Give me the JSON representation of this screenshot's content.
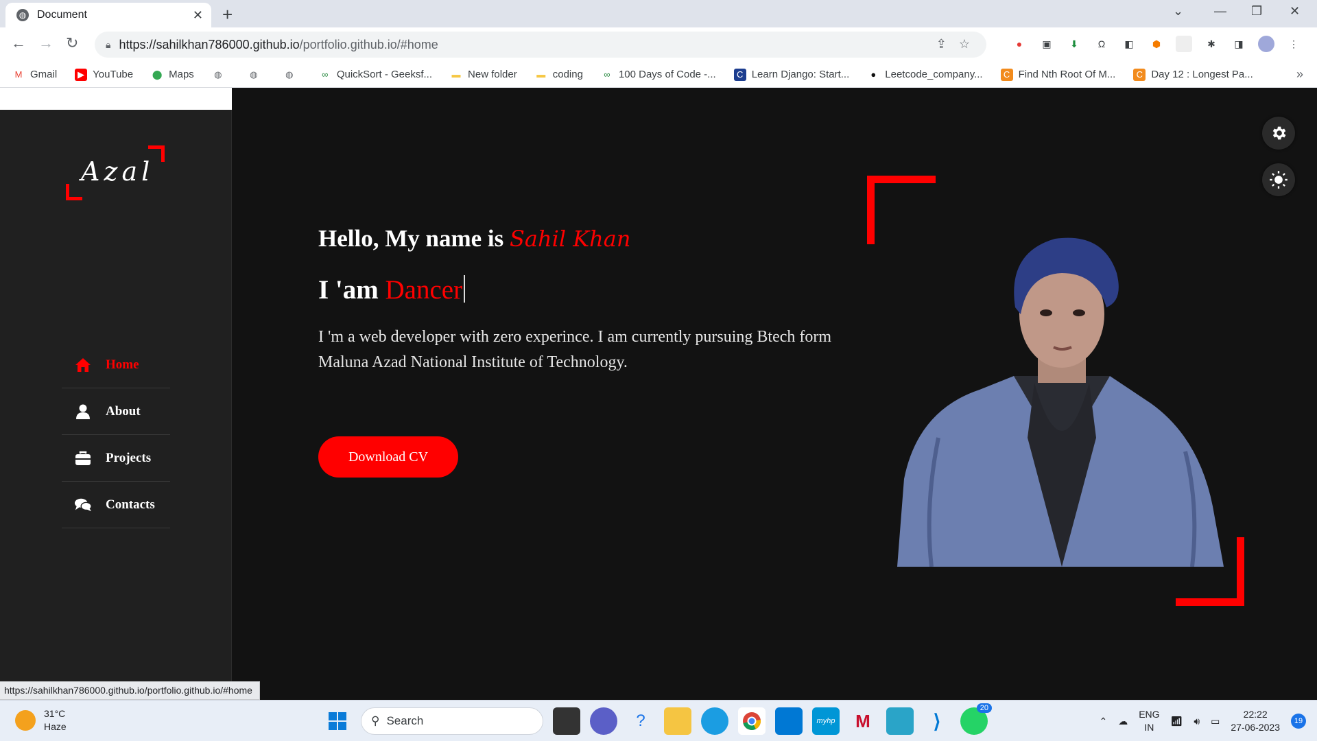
{
  "browser": {
    "tab_title": "Document",
    "url_host": "https://sahilkhan786000.github.io",
    "url_path": "/portfolio.github.io/#home",
    "status_url": "https://sahilkhan786000.github.io/portfolio.github.io/#home",
    "bookmarks": [
      {
        "label": "Gmail",
        "icon": "gmail-icon"
      },
      {
        "label": "YouTube",
        "icon": "youtube-icon"
      },
      {
        "label": "Maps",
        "icon": "maps-icon"
      },
      {
        "label": "",
        "icon": "globe-icon"
      },
      {
        "label": "",
        "icon": "globe-icon"
      },
      {
        "label": "",
        "icon": "globe-icon"
      },
      {
        "label": "QuickSort - Geeksf...",
        "icon": "gfg-icon"
      },
      {
        "label": "New folder",
        "icon": "folder-icon"
      },
      {
        "label": "coding",
        "icon": "folder-icon"
      },
      {
        "label": "100 Days of Code -...",
        "icon": "gfg-icon"
      },
      {
        "label": "Learn Django: Start...",
        "icon": "cal-icon"
      },
      {
        "label": "Leetcode_company...",
        "icon": "github-icon"
      },
      {
        "label": "Find Nth Root Of M...",
        "icon": "codestudio-icon"
      },
      {
        "label": "Day 12 : Longest Pa...",
        "icon": "codestudio-icon"
      }
    ]
  },
  "site": {
    "logo": "Azal",
    "nav": [
      {
        "label": "Home",
        "icon": "home-icon",
        "active": true
      },
      {
        "label": "About",
        "icon": "user-icon",
        "active": false
      },
      {
        "label": "Projects",
        "icon": "briefcase-icon",
        "active": false
      },
      {
        "label": "Contacts",
        "icon": "comments-icon",
        "active": false
      }
    ],
    "hero": {
      "greeting_prefix": "Hello, My name is ",
      "name": "Sahil Khan",
      "role_prefix": "I 'am ",
      "role_word": "Dancer",
      "bio": "I 'm a web developer with zero experince. I am currently pursuing Btech form Maluna Azad National Institute of Technology.",
      "cv_button": "Download CV"
    },
    "colors": {
      "accent": "#ff0000",
      "background": "#121212",
      "sidebar": "#202020"
    }
  },
  "taskbar": {
    "weather_temp": "31°C",
    "weather_desc": "Haze",
    "search_placeholder": "Search",
    "whatsapp_badge": "20",
    "lang_top": "ENG",
    "lang_bottom": "IN",
    "time": "22:22",
    "date": "27-06-2023",
    "notifications": "19"
  }
}
